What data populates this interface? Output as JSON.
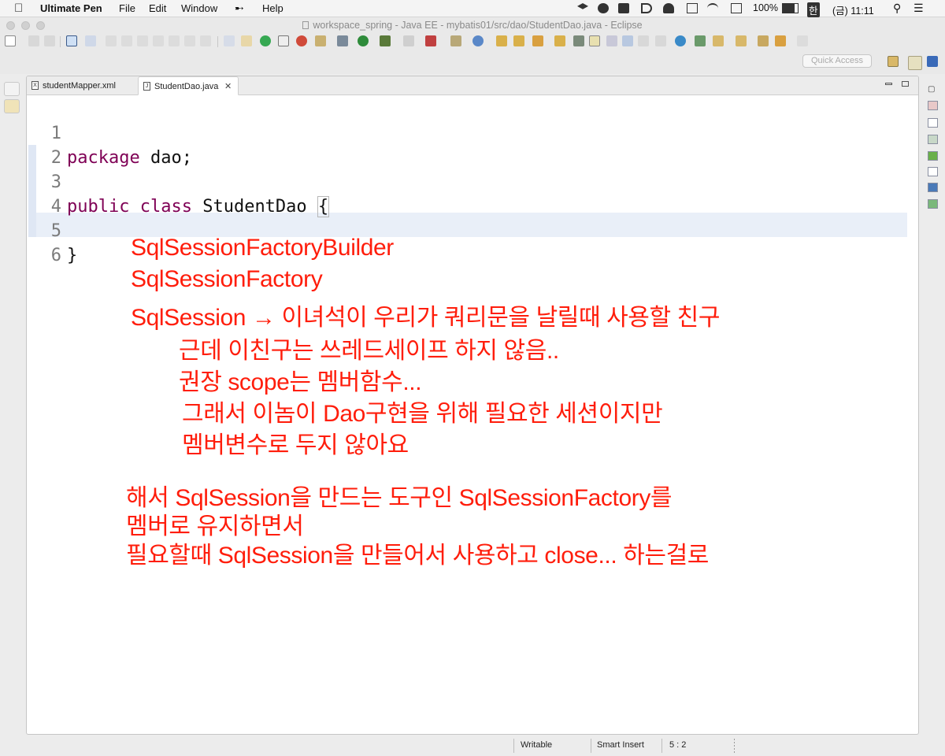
{
  "menubar": {
    "app_name": "Ultimate Pen",
    "items": [
      "File",
      "Edit",
      "Window",
      "Help"
    ],
    "status": {
      "battery": "100%",
      "input_method": "한",
      "clock": "(금) 11:11"
    }
  },
  "window": {
    "title": "workspace_spring - Java EE - mybatis01/src/dao/StudentDao.java - Eclipse"
  },
  "toolbar": {
    "quick_access_placeholder": "Quick Access"
  },
  "editor": {
    "tabs": [
      {
        "label": "studentMapper.xml",
        "icon": "X",
        "active": false
      },
      {
        "label": "StudentDao.java",
        "icon": "J",
        "active": true
      }
    ],
    "line_numbers": [
      "1",
      "2",
      "3",
      "4",
      "5",
      "6"
    ],
    "code": {
      "l1_kw": "package",
      "l1_rest": " dao;",
      "l3_kw1": "public",
      "l3_kw2": "class",
      "l3_rest": " StudentDao ",
      "l3_brace": "{",
      "l5": "}"
    },
    "annotation_color": "#ff1d0b",
    "annotations": [
      "SqlSessionFactoryBuilder",
      "SqlSessionFactory",
      "SqlSession → 이녀석이 우리가 쿼리문을 날릴때 사용할 친구",
      "근데 이친구는 쓰레드세이프 하지 않음..",
      "권장 scope는 멤버함수...",
      "그래서 이놈이 Dao구현을 위해 필요한 세션이지만",
      "멤버변수로 두지 않아요",
      "해서 SqlSession을 만드는 도구인 SqlSessionFactory를",
      "멤버로 유지하면서",
      "필요할때 SqlSession을 만들어서 사용하고 close... 하는걸로"
    ]
  },
  "statusbar": {
    "writable": "Writable",
    "insert_mode": "Smart Insert",
    "cursor": "5 : 2"
  }
}
